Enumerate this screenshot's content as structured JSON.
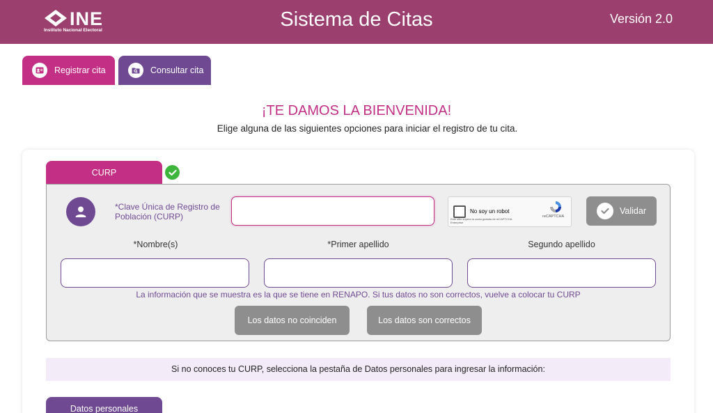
{
  "header": {
    "logo_text": "INE",
    "logo_subtitle": "Instituto Nacional Electoral",
    "title": "Sistema de Citas",
    "version": "Versión 2.0"
  },
  "tabs": [
    {
      "label": "Registrar cita",
      "icon": "id-card-icon"
    },
    {
      "label": "Consultar cita",
      "icon": "folder-search-icon"
    }
  ],
  "welcome": {
    "title": "¡TE DAMOS LA BIENVENIDA!",
    "subtitle": "Elige alguna de las siguientes opciones para iniciar el registro de tu cita."
  },
  "curp_section": {
    "tab_label": "CURP",
    "status": "check-icon",
    "curp_label": "*Clave Única de Registro de Población (CURP)",
    "curp_value": "",
    "recaptcha": {
      "label": "No soy un robot",
      "brand": "reCAPTCHA",
      "note": "Este sitio supera la cuota gratuita de reCAPTCHA Enterprise"
    },
    "validate_label": "Validar",
    "fields": [
      {
        "label": "*Nombre(s)",
        "value": ""
      },
      {
        "label": "*Primer apellido",
        "value": ""
      },
      {
        "label": "Segundo apellido",
        "value": ""
      }
    ],
    "renapo_note": "La información que se muestra es la que se tiene en RENAPO. Si tus datos no son correctos, vuelve a colocar tu CURP",
    "mismatch_label": "Los datos no coinciden",
    "correct_label": "Los datos son correctos"
  },
  "hint": "Si no conoces tu CURP, selecciona la pestaña de Datos personales para ingresar la información:",
  "personal_tab_label": "Datos personales",
  "colors": {
    "header": "#9b3f6e",
    "primary_pink": "#c22f84",
    "primary_purple": "#6f4a92",
    "success": "#3db53d",
    "disabled": "#8e8e8e"
  }
}
